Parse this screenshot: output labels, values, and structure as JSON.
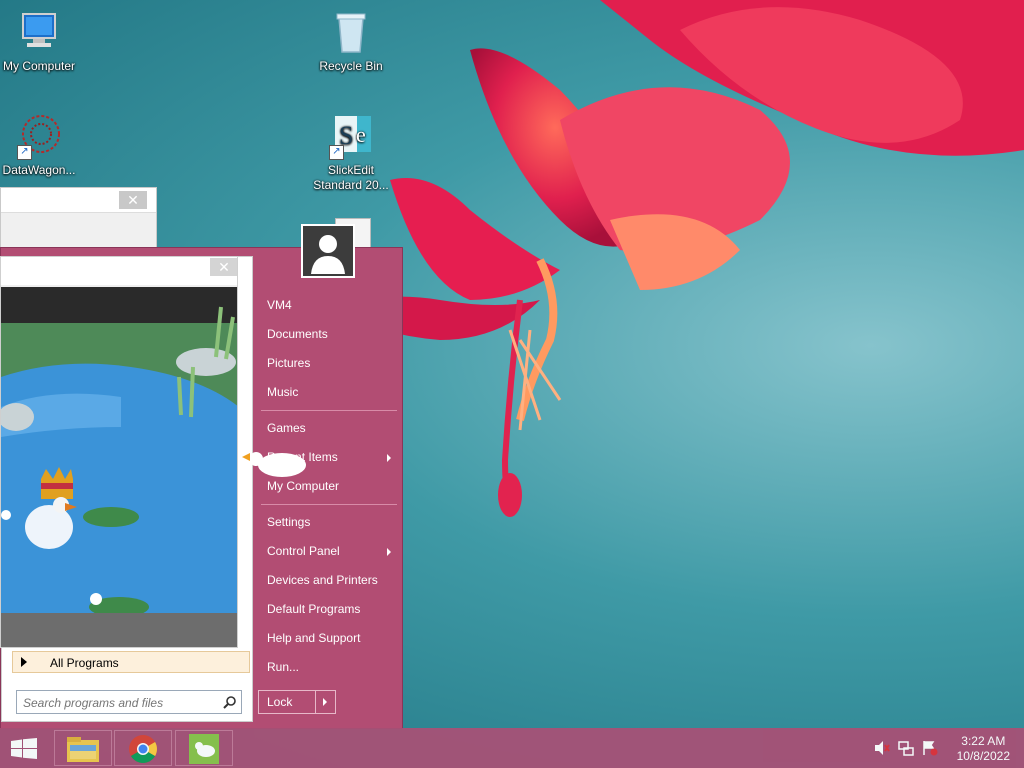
{
  "desktop": {
    "icons": [
      {
        "label": "My Computer"
      },
      {
        "label": "Recycle Bin"
      },
      {
        "label": "DataWagon..."
      },
      {
        "label": "SlickEdit Standard 20..."
      }
    ]
  },
  "start_menu": {
    "right_items": [
      {
        "label": "VM4"
      },
      {
        "label": "Documents"
      },
      {
        "label": "Pictures"
      },
      {
        "label": "Music"
      },
      {
        "label": "Games"
      },
      {
        "label": "Recent Items"
      },
      {
        "label": "My Computer"
      },
      {
        "label": "Settings"
      },
      {
        "label": "Control Panel"
      },
      {
        "label": "Devices and Printers"
      },
      {
        "label": "Default Programs"
      },
      {
        "label": "Help and Support"
      },
      {
        "label": "Run..."
      }
    ],
    "all_programs": "All Programs",
    "search_placeholder": "Search programs and files",
    "lock_label": "Lock"
  },
  "taskbar": {
    "time": "3:22 AM",
    "date": "10/8/2022"
  },
  "colors": {
    "start_menu_bg": "#b24d73",
    "taskbar_bg": "#a75176"
  }
}
